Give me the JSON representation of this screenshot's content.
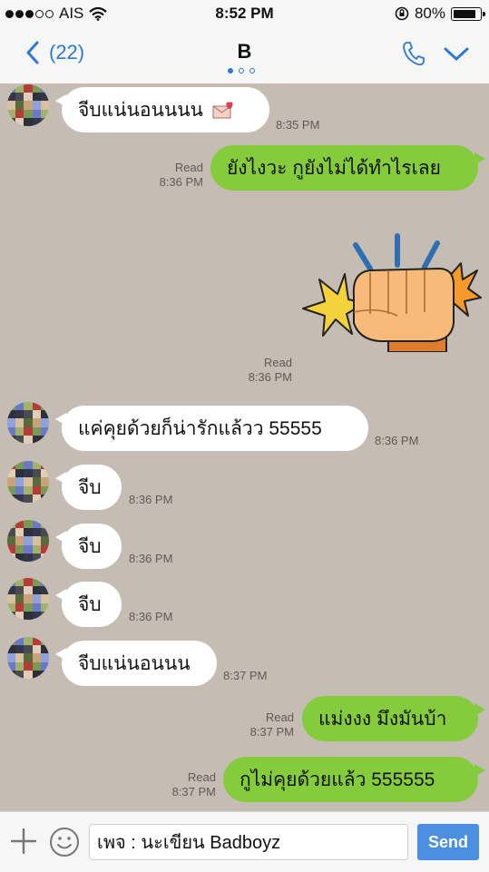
{
  "status_bar": {
    "carrier": "AIS",
    "time": "8:52 PM",
    "battery": "80%"
  },
  "header": {
    "back_label": "(22)",
    "title": "B"
  },
  "messages": [
    {
      "side": "in",
      "text": "จีบแน่นอนนนน",
      "time": "8:35 PM",
      "has_emoji": true
    },
    {
      "side": "out",
      "text": "ยังไงวะ กูยังไม่ได้ทำไรเลย",
      "read": "Read",
      "time": "8:36 PM"
    },
    {
      "side": "out",
      "type": "sticker",
      "sticker": "punching-fist",
      "read": "Read",
      "time": "8:36 PM"
    },
    {
      "side": "in",
      "text": "แค่คุยด้วยก็น่ารักแล้วว 55555",
      "time": "8:36 PM"
    },
    {
      "side": "in",
      "text": "จีบ",
      "time": "8:36 PM"
    },
    {
      "side": "in",
      "text": "จีบ",
      "time": "8:36 PM"
    },
    {
      "side": "in",
      "text": "จีบ",
      "time": "8:36 PM"
    },
    {
      "side": "in",
      "text": "จีบแน่นอนนน",
      "time": "8:37 PM"
    },
    {
      "side": "out",
      "text": "แม่งงง มึงมันบ้า",
      "read": "Read",
      "time": "8:37 PM"
    },
    {
      "side": "out",
      "text": "กูไม่คุยด้วยแล้ว 555555",
      "read": "Read",
      "time": "8:37 PM"
    }
  ],
  "composer": {
    "value": "เพจ : นะเขียน Badboyz",
    "send_label": "Send"
  },
  "colors": {
    "accent": "#2d7ad6",
    "outgoing_bubble": "#84cc3c",
    "incoming_bubble": "#ffffff",
    "chat_background": "#c5bdb4",
    "send_button": "#4b8fe0"
  }
}
